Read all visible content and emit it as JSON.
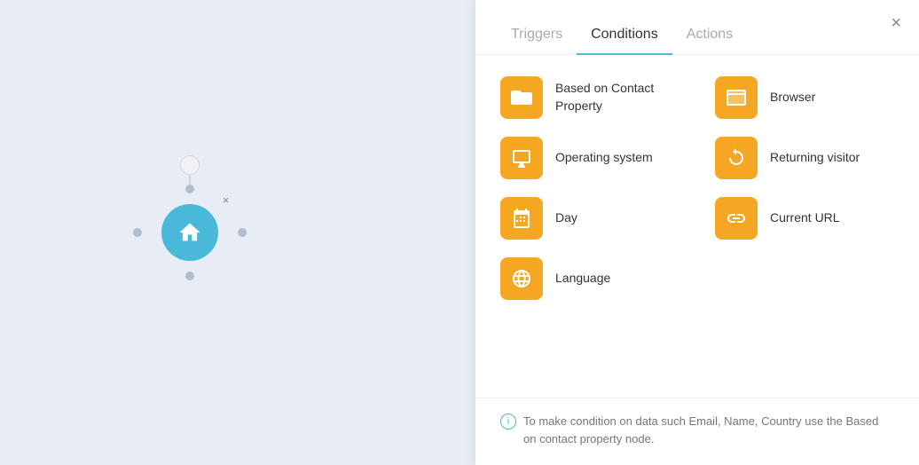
{
  "canvas": {
    "node_close_label": "×"
  },
  "panel": {
    "close_label": "×",
    "tabs": [
      {
        "id": "triggers",
        "label": "Triggers",
        "active": false
      },
      {
        "id": "conditions",
        "label": "Conditions",
        "active": true
      },
      {
        "id": "actions",
        "label": "Actions",
        "active": false
      }
    ],
    "conditions": [
      {
        "id": "based-on-contact",
        "label": "Based on Contact Property",
        "icon": "folder"
      },
      {
        "id": "browser",
        "label": "Browser",
        "icon": "browser"
      },
      {
        "id": "operating-system",
        "label": "Operating system",
        "icon": "monitor"
      },
      {
        "id": "returning-visitor",
        "label": "Returning visitor",
        "icon": "refresh"
      },
      {
        "id": "day",
        "label": "Day",
        "icon": "calendar"
      },
      {
        "id": "current-url",
        "label": "Current URL",
        "icon": "link"
      },
      {
        "id": "language",
        "label": "Language",
        "icon": "globe"
      }
    ],
    "footer_note": "To make condition on data such Email, Name, Country use the Based on contact property node."
  }
}
